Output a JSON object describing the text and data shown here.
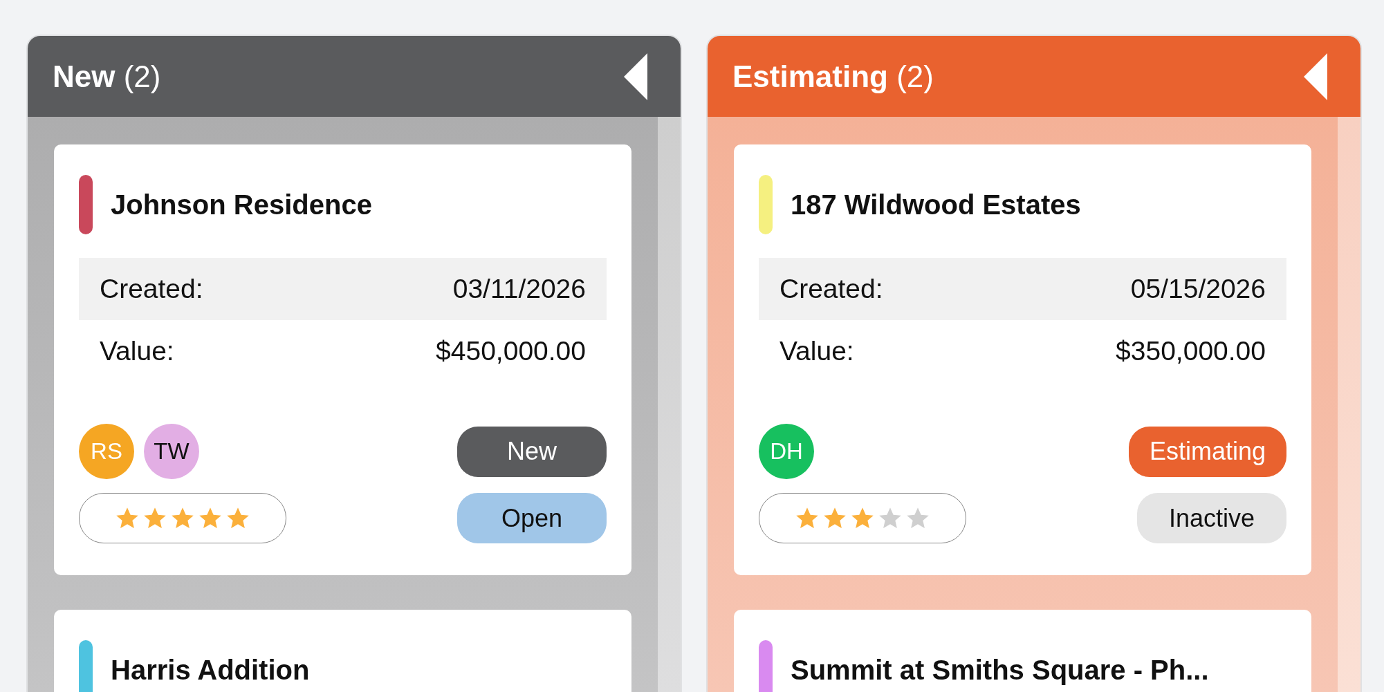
{
  "columns": [
    {
      "title": "**New** (2)",
      "color": "#5a5b5d",
      "cards": [
        {
          "title": "Johnson Residence",
          "color": "#c9485b",
          "fields": [
            {
              "label": "Created:",
              "value": "03/11/2026"
            },
            {
              "label": "Value:",
              "value": "$450,000.00"
            }
          ],
          "avatars": [
            {
              "initials": "RS",
              "color": "#f5a623"
            },
            {
              "initials": "TW",
              "color": "#e2aee4"
            }
          ],
          "stars": 5,
          "badges": [
            {
              "text": "New",
              "color": "#5a5b5d"
            },
            {
              "text": "Open",
              "color": "#a0c6e8"
            }
          ]
        },
        {
          "title": "Harris Addition",
          "color": "#4ec3e0"
        }
      ]
    },
    {
      "title": "**Estimating** (2)",
      "color": "#e9622f",
      "cards": [
        {
          "title": "187 Wildwood Estates",
          "color": "#f5f080",
          "fields": [
            {
              "label": "Created:",
              "value": "05/15/2026"
            },
            {
              "label": "Value:",
              "value": "$350,000.00"
            }
          ],
          "avatars": [
            {
              "initials": "DH",
              "color": "#17c05f"
            }
          ],
          "stars": 3,
          "badges": [
            {
              "text": "Estimating",
              "color": "#e9622f"
            },
            {
              "text": "Inactive",
              "color": "#e5e5e5"
            }
          ]
        },
        {
          "title": "Summit at Smiths Square - Ph...",
          "color": "#d98af0"
        }
      ]
    }
  ]
}
